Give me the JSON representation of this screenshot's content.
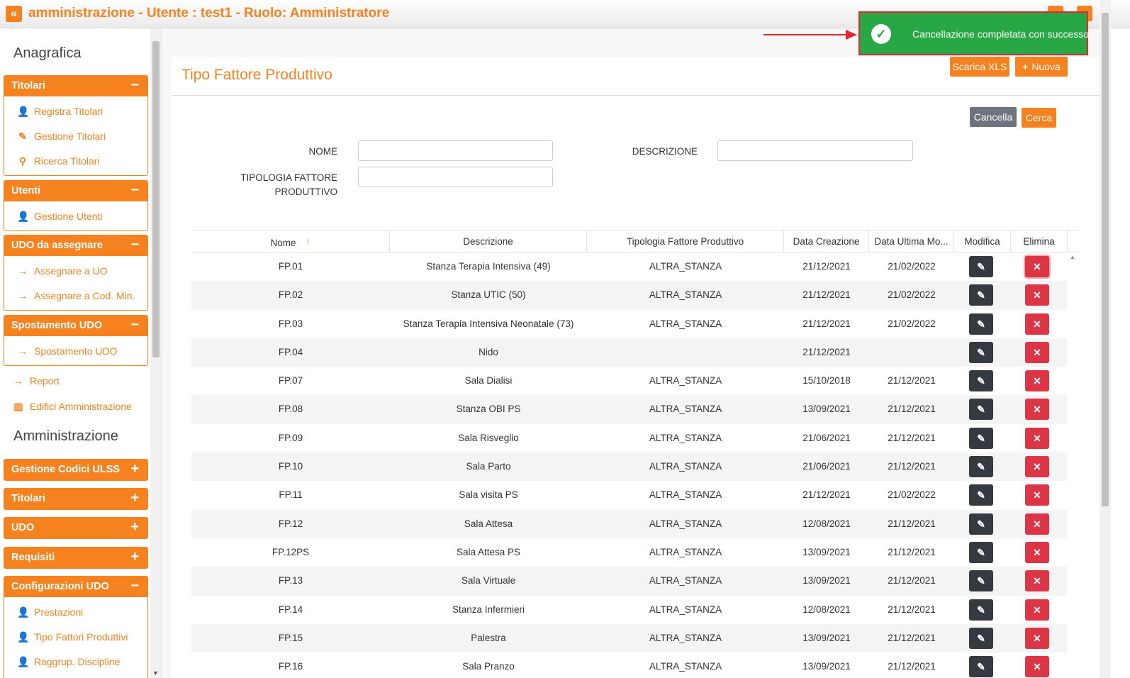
{
  "header": {
    "collapse_glyph": "«",
    "title": "amministrazione - Utente : test1 - Ruolo: Amministratore"
  },
  "sidebar": {
    "anagrafica_heading": "Anagrafica",
    "amministrazione_heading": "Amministrazione",
    "panels": [
      {
        "title": "Titolari",
        "toggle": "−",
        "items": [
          {
            "label": "Registra Titolari",
            "icon": "user-edit-icon"
          },
          {
            "label": "Gestione Titolari",
            "icon": "edit-icon"
          },
          {
            "label": "Ricerca Titolari",
            "icon": "search-icon"
          }
        ]
      },
      {
        "title": "Utenti",
        "toggle": "−",
        "items": [
          {
            "label": "Gestione Utenti",
            "icon": "user-edit-icon"
          }
        ]
      },
      {
        "title": "UDO da assegnare",
        "toggle": "−",
        "items": [
          {
            "label": "Assegnare a UO",
            "icon": "arrow-right-icon"
          },
          {
            "label": "Assegnare a Cod. Min.",
            "icon": "arrow-right-icon"
          }
        ]
      },
      {
        "title": "Spostamento UDO",
        "toggle": "−",
        "items": [
          {
            "label": "Spostamento UDO",
            "icon": "arrow-right-icon"
          }
        ]
      }
    ],
    "links": [
      {
        "label": "Report",
        "icon": "arrow-right-icon"
      },
      {
        "label": "Edifici Amministrazione",
        "icon": "building-icon"
      }
    ],
    "admin_panels": [
      {
        "title": "Gestione Codici ULSS",
        "toggle": "+"
      },
      {
        "title": "Titolari",
        "toggle": "+"
      },
      {
        "title": "UDO",
        "toggle": "+"
      },
      {
        "title": "Requisiti",
        "toggle": "+"
      }
    ],
    "config_panel": {
      "title": "Configurazioni UDO",
      "toggle": "−",
      "items": [
        {
          "label": "Prestazioni",
          "icon": "user-edit-icon"
        },
        {
          "label": "Tipo Fattori Produttivi",
          "icon": "user-edit-icon"
        },
        {
          "label": "Raggrup. Discipline",
          "icon": "user-edit-icon"
        }
      ]
    }
  },
  "main": {
    "page_title": "Tipo Fattore Produttivo",
    "toolbar": {
      "download_label": "Scarica XLS",
      "new_label": "Nuova",
      "new_glyph": "+"
    },
    "filter": {
      "cancel_label": "Cancella",
      "search_label": "Cerca",
      "nome_label": "NOME",
      "descrizione_label": "DESCRIZIONE",
      "tipologia_label_line1": "TIPOLOGIA FATTORE",
      "tipologia_label_line2": "PRODUTTIVO",
      "nome_value": "",
      "descrizione_value": "",
      "tipologia_value": ""
    },
    "table": {
      "headers": {
        "nome": "Nome",
        "descrizione": "Descrizione",
        "tipologia": "Tipologia Fattore Produttivo",
        "data_creazione": "Data Creazione",
        "data_ultima": "Data Ultima Mo...",
        "modifica": "Modifica",
        "elimina": "Elimina"
      },
      "sort_glyph": "↑",
      "edit_glyph": "✎",
      "delete_glyph": "✕",
      "rows": [
        {
          "nome": "FP.01",
          "descrizione": "Stanza Terapia Intensiva (49)",
          "tipologia": "ALTRA_STANZA",
          "creazione": "21/12/2021",
          "ultima": "21/02/2022"
        },
        {
          "nome": "FP.02",
          "descrizione": "Stanza UTIC (50)",
          "tipologia": "ALTRA_STANZA",
          "creazione": "21/12/2021",
          "ultima": "21/02/2022"
        },
        {
          "nome": "FP.03",
          "descrizione": "Stanza Terapia Intensiva Neonatale (73)",
          "tipologia": "ALTRA_STANZA",
          "creazione": "21/12/2021",
          "ultima": "21/02/2022"
        },
        {
          "nome": "FP.04",
          "descrizione": "Nido",
          "tipologia": "",
          "creazione": "21/12/2021",
          "ultima": ""
        },
        {
          "nome": "FP.07",
          "descrizione": "Sala Dialisi",
          "tipologia": "ALTRA_STANZA",
          "creazione": "15/10/2018",
          "ultima": "21/12/2021"
        },
        {
          "nome": "FP.08",
          "descrizione": "Stanza OBI PS",
          "tipologia": "ALTRA_STANZA",
          "creazione": "13/09/2021",
          "ultima": "21/12/2021"
        },
        {
          "nome": "FP.09",
          "descrizione": "Sala Risveglio",
          "tipologia": "ALTRA_STANZA",
          "creazione": "21/06/2021",
          "ultima": "21/12/2021"
        },
        {
          "nome": "FP.10",
          "descrizione": "Sala Parto",
          "tipologia": "ALTRA_STANZA",
          "creazione": "21/06/2021",
          "ultima": "21/12/2021"
        },
        {
          "nome": "FP.11",
          "descrizione": "Sala visita PS",
          "tipologia": "ALTRA_STANZA",
          "creazione": "21/12/2021",
          "ultima": "21/02/2022"
        },
        {
          "nome": "FP.12",
          "descrizione": "Sala Attesa",
          "tipologia": "ALTRA_STANZA",
          "creazione": "12/08/2021",
          "ultima": "21/12/2021"
        },
        {
          "nome": "FP.12PS",
          "descrizione": "Sala Attesa PS",
          "tipologia": "ALTRA_STANZA",
          "creazione": "13/09/2021",
          "ultima": "21/12/2021"
        },
        {
          "nome": "FP.13",
          "descrizione": "Sala Virtuale",
          "tipologia": "ALTRA_STANZA",
          "creazione": "13/09/2021",
          "ultima": "21/12/2021"
        },
        {
          "nome": "FP.14",
          "descrizione": "Stanza Infermieri",
          "tipologia": "ALTRA_STANZA",
          "creazione": "12/08/2021",
          "ultima": "21/12/2021"
        },
        {
          "nome": "FP.15",
          "descrizione": "Palestra",
          "tipologia": "ALTRA_STANZA",
          "creazione": "13/09/2021",
          "ultima": "21/12/2021"
        },
        {
          "nome": "FP.16",
          "descrizione": "Sala Pranzo",
          "tipologia": "ALTRA_STANZA",
          "creazione": "13/09/2021",
          "ultima": "21/12/2021"
        }
      ]
    }
  },
  "toast": {
    "message": "Cancellazione completata con successo",
    "check_glyph": "✓"
  },
  "colors": {
    "accent": "#f5821f",
    "success": "#28a745",
    "danger": "#dc3545",
    "dark": "#343a40",
    "annotation": "#e3262f"
  }
}
